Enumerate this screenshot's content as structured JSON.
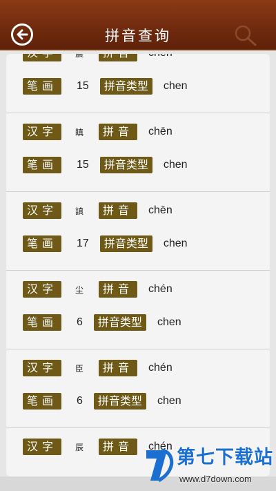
{
  "header": {
    "title": "拼音查询",
    "back_icon": "back-arrow-icon",
    "search_icon": "search-icon",
    "bg_color": "#6f2a0e"
  },
  "labels": {
    "hanzi": "汉字",
    "pinyin": "拼音",
    "strokes": "笔画",
    "pinyin_type": "拼音类型"
  },
  "items": [
    {
      "hanzi": "晨",
      "pinyin": "chēn",
      "strokes": "15",
      "type": "chen"
    },
    {
      "hanzi": "瞋",
      "pinyin": "chēn",
      "strokes": "15",
      "type": "chen"
    },
    {
      "hanzi": "謓",
      "pinyin": "chēn",
      "strokes": "17",
      "type": "chen"
    },
    {
      "hanzi": "尘",
      "pinyin": "chén",
      "strokes": "6",
      "type": "chen"
    },
    {
      "hanzi": "臣",
      "pinyin": "chén",
      "strokes": "6",
      "type": "chen"
    },
    {
      "hanzi": "辰",
      "pinyin": "chén",
      "strokes": "",
      "type": ""
    }
  ],
  "watermark": {
    "cn": "第七下载站",
    "url": "www.d7down.com"
  },
  "colors": {
    "tag_bg": "#6e5a16",
    "watermark_blue": "#1b6fd0"
  }
}
